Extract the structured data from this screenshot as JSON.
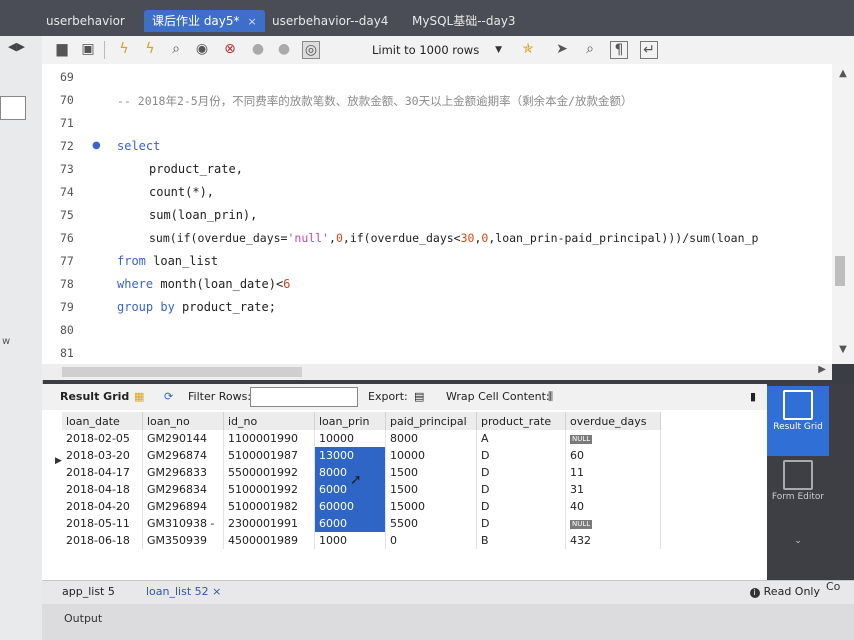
{
  "tabs": [
    {
      "label": "userbehavior"
    },
    {
      "label": "课后作业 day5*",
      "close": "×"
    },
    {
      "label": "userbehavior--day4"
    },
    {
      "label": "MySQL基础--day3"
    }
  ],
  "toolbar": {
    "limit_label": "Limit to 1000 rows"
  },
  "editor": {
    "line_numbers": [
      "69",
      "70",
      "71",
      "72",
      "73",
      "74",
      "75",
      "76",
      "77",
      "78",
      "79",
      "80",
      "81"
    ],
    "lines": {
      "l70": "-- 2018年2-5月份，不同费率的放款笔数、放款金额、30天以上金额逾期率（剩余本金/放款金额）",
      "l72": "select",
      "l73": "product_rate,",
      "l74": "count(*),",
      "l75": "sum(loan_prin),",
      "l76a": "sum(if(overdue_days=",
      "l76b": "'null'",
      "l76c": ",",
      "l76d": "0",
      "l76e": ",if(overdue_days<",
      "l76f": "30",
      "l76g": ",",
      "l76h": "0",
      "l76i": ",loan_prin-paid_principal)))/sum(loan_p",
      "l77a": "from",
      "l77b": " loan_list",
      "l78a": "where",
      "l78b": " month(loan_date)<",
      "l78c": "6",
      "l79a": "group by",
      "l79b": " product_rate;"
    }
  },
  "result_toolbar": {
    "result_grid": "Result Grid",
    "filter_rows": "Filter Rows:",
    "export": "Export:",
    "wrap": "Wrap Cell Content:"
  },
  "grid": {
    "columns": [
      "loan_date",
      "loan_no",
      "id_no",
      "loan_prin",
      "paid_principal",
      "product_rate",
      "overdue_days"
    ],
    "rows": [
      [
        "2018-02-05",
        "GM290144",
        "1100001990",
        "10000",
        "8000",
        "A",
        "NULL"
      ],
      [
        "2018-03-20",
        "GM296874",
        "5100001987",
        "13000",
        "10000",
        "D",
        "60"
      ],
      [
        "2018-04-17",
        "GM296833",
        "5500001992",
        "8000",
        "1500",
        "D",
        "11"
      ],
      [
        "2018-04-18",
        "GM296834",
        "5100001992",
        "6000",
        "1500",
        "D",
        "31"
      ],
      [
        "2018-04-20",
        "GM296894",
        "5100001982",
        "60000",
        "15000",
        "D",
        "40"
      ],
      [
        "2018-05-11",
        "GM310938 -",
        "2300001991",
        "6000",
        "5500",
        "D",
        "NULL"
      ],
      [
        "2018-06-18",
        "GM350939",
        "4500001989",
        "1000",
        "0",
        "B",
        "432"
      ]
    ]
  },
  "right_panel": {
    "result_grid": "Result\nGrid",
    "form_editor": "Form\nEditor"
  },
  "bottom": {
    "tab1": "app_list 5",
    "tab2": "loan_list 52",
    "tab2_close": "×",
    "read_only": "Read Only",
    "corner": "Co",
    "output": "Output"
  },
  "colors": {
    "selection": "#2f66c6",
    "keyword": "#3a64c8",
    "active_tab": "#3d6fc9"
  }
}
